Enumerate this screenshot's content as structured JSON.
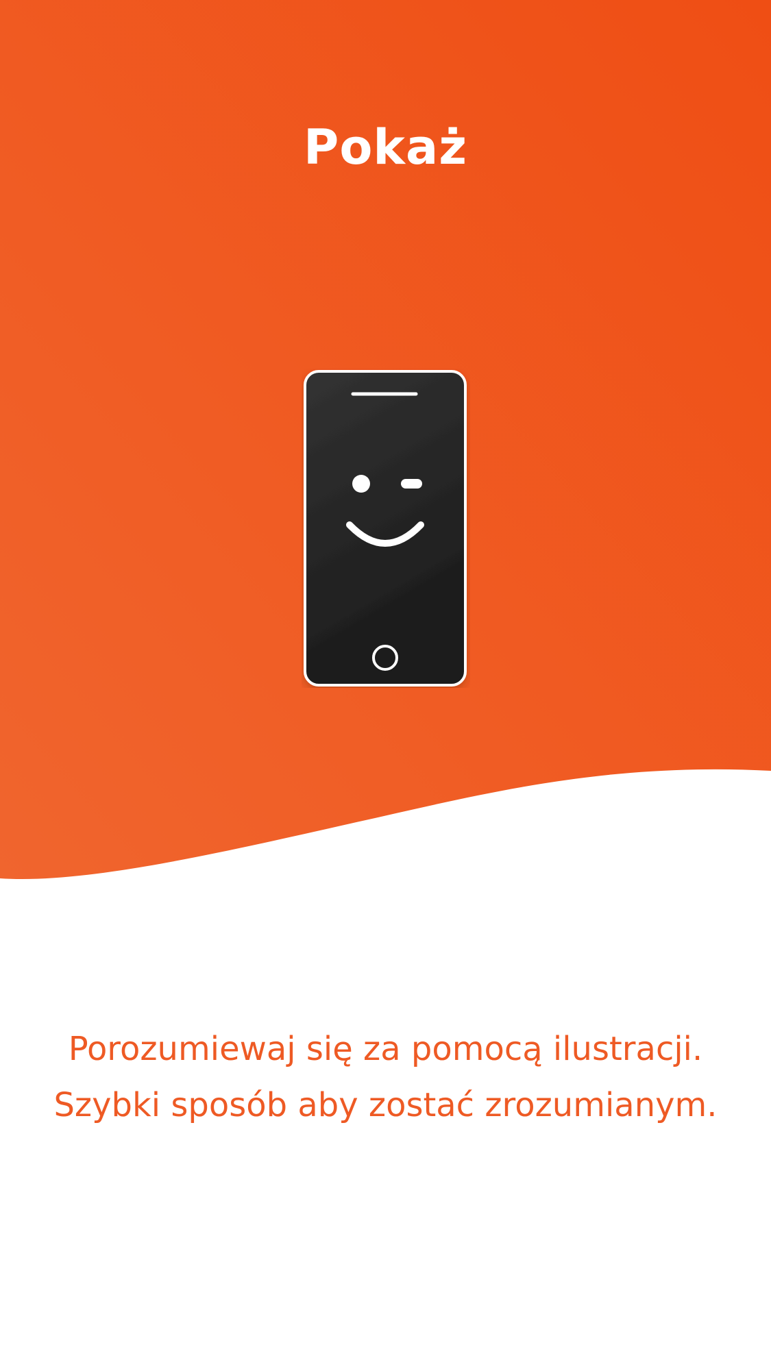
{
  "onboarding": {
    "title": "Pokaż",
    "description_line1": "Porozumiewaj się za pomocą ilustracji.",
    "description_line2": "Szybki sposób aby zostać zrozumianym."
  },
  "illustration": {
    "icon": "winking-phone-icon"
  },
  "colors": {
    "accent": "#ee5a24",
    "accent_dark": "#ef4e14",
    "accent_light": "#f0652e",
    "phone_body": "#262626",
    "background": "#ffffff"
  }
}
